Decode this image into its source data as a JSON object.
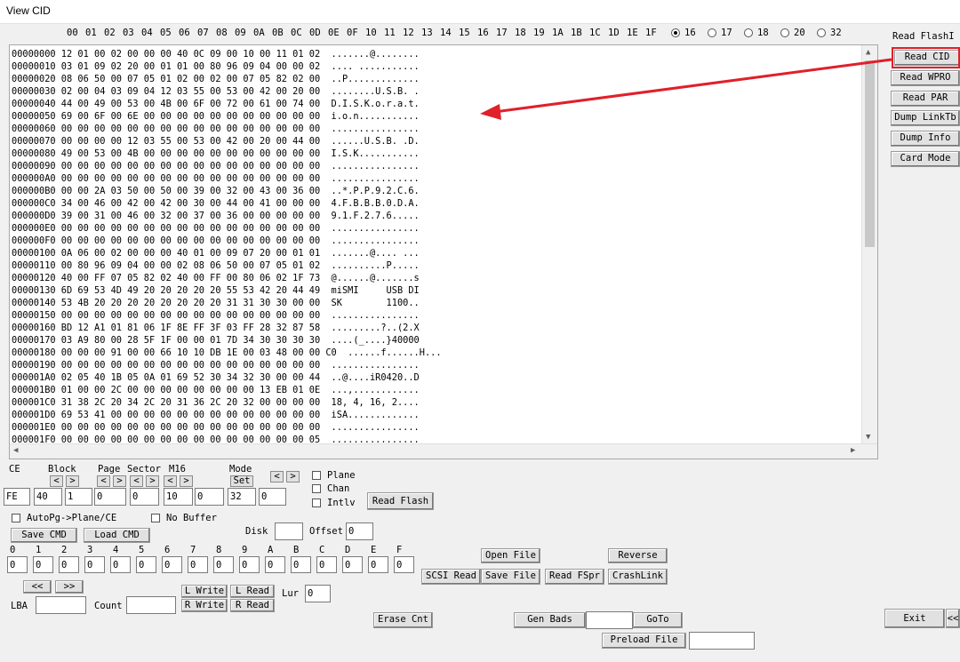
{
  "window": {
    "title": "View CID"
  },
  "header": {
    "columns": [
      "00",
      "01",
      "02",
      "03",
      "04",
      "05",
      "06",
      "07",
      "08",
      "09",
      "0A",
      "0B",
      "0C",
      "0D",
      "0E",
      "0F",
      "10",
      "11",
      "12",
      "13",
      "14",
      "15",
      "16",
      "17",
      "18",
      "19",
      "1A",
      "1B",
      "1C",
      "1D",
      "1E",
      "1F"
    ],
    "width_options": [
      {
        "label": "16",
        "selected": true
      },
      {
        "label": "17",
        "selected": false
      },
      {
        "label": "18",
        "selected": false
      },
      {
        "label": "20",
        "selected": false
      },
      {
        "label": "32",
        "selected": false
      }
    ]
  },
  "dump": {
    "lines": [
      "00000000 12 01 00 02 00 00 00 40 0C 09 00 10 00 11 01 02  .......@........",
      "00000010 03 01 09 02 20 00 01 01 00 80 96 09 04 00 00 02  .... ...........",
      "00000020 08 06 50 00 07 05 01 02 00 02 00 07 05 82 02 00  ..P.............",
      "00000030 02 00 04 03 09 04 12 03 55 00 53 00 42 00 20 00  ........U.S.B. .",
      "00000040 44 00 49 00 53 00 4B 00 6F 00 72 00 61 00 74 00  D.I.S.K.o.r.a.t.",
      "00000050 69 00 6F 00 6E 00 00 00 00 00 00 00 00 00 00 00  i.o.n...........",
      "00000060 00 00 00 00 00 00 00 00 00 00 00 00 00 00 00 00  ................",
      "00000070 00 00 00 00 12 03 55 00 53 00 42 00 20 00 44 00  ......U.S.B. .D.",
      "00000080 49 00 53 00 4B 00 00 00 00 00 00 00 00 00 00 00  I.S.K...........",
      "00000090 00 00 00 00 00 00 00 00 00 00 00 00 00 00 00 00  ................",
      "000000A0 00 00 00 00 00 00 00 00 00 00 00 00 00 00 00 00  ................",
      "000000B0 00 00 2A 03 50 00 50 00 39 00 32 00 43 00 36 00  ..*.P.P.9.2.C.6.",
      "000000C0 34 00 46 00 42 00 42 00 30 00 44 00 41 00 00 00  4.F.B.B.B.0.D.A.",
      "000000D0 39 00 31 00 46 00 32 00 37 00 36 00 00 00 00 00  9.1.F.2.7.6.....",
      "000000E0 00 00 00 00 00 00 00 00 00 00 00 00 00 00 00 00  ................",
      "000000F0 00 00 00 00 00 00 00 00 00 00 00 00 00 00 00 00  ................",
      "00000100 0A 06 00 02 00 00 00 40 01 00 09 07 20 00 01 01  .......@.... ...",
      "00000110 00 80 96 09 04 00 00 02 08 06 50 00 07 05 01 02  ..........P.....",
      "00000120 40 00 FF 07 05 82 02 40 00 FF 00 80 06 02 1F 73  @......@.......s",
      "00000130 6D 69 53 4D 49 20 20 20 20 20 55 53 42 20 44 49  miSMI     USB DI",
      "00000140 53 4B 20 20 20 20 20 20 20 20 31 31 30 30 00 00  SK        1100..",
      "00000150 00 00 00 00 00 00 00 00 00 00 00 00 00 00 00 00  ................",
      "00000160 BD 12 A1 01 81 06 1F 8E FF 3F 03 FF 28 32 87 58  .........?..(2.X",
      "00000170 03 A9 80 00 28 5F 1F 00 00 01 7D 34 30 30 30 30  ....(_....}40000",
      "00000180 00 00 00 91 00 00 66 10 10 DB 1E 00 03 48 00 00 C0  ......f......H...",
      "00000190 00 00 00 00 00 00 00 00 00 00 00 00 00 00 00 00  ................",
      "000001A0 02 05 40 1B 05 0A 01 69 52 30 34 32 30 00 00 44  ..@....iR0420..D",
      "000001B0 01 00 00 2C 00 00 00 00 00 00 00 00 13 EB 01 0E  ...,............",
      "000001C0 31 38 2C 20 34 2C 20 31 36 2C 20 32 00 00 00 00  18, 4, 16, 2....",
      "000001D0 69 53 41 00 00 00 00 00 00 00 00 00 00 00 00 00  iSA.............",
      "000001E0 00 00 00 00 00 00 00 00 00 00 00 00 00 00 00 00  ................",
      "000001F0 00 00 00 00 00 00 00 00 00 00 00 00 00 00 00 05  ................"
    ]
  },
  "right_panel": {
    "read_flash_id": "Read FlashI",
    "read_cid": "Read CID",
    "read_wpro": "Read WPRO",
    "read_par": "Read PAR",
    "dump_linktb": "Dump LinkTb",
    "dump_info": "Dump Info",
    "card_mode": "Card Mode"
  },
  "params": {
    "ce_label": "CE",
    "block_label": "Block",
    "page_label": "Page",
    "sector_label": "Sector",
    "m16_label": "M16",
    "mode_label": "Mode",
    "mode_set": "Set",
    "values": {
      "ce": "FE",
      "block_a": "40",
      "block_b": "1",
      "page_a": "0",
      "page_b": "0",
      "sector_a": "10",
      "sector_b": "0",
      "mode_a": "32",
      "mode_b": "0"
    },
    "plane": "Plane",
    "chan": "Chan",
    "intlv": "Intlv",
    "read_flash": "Read Flash",
    "autopg": "AutoPg->Plane/CE",
    "no_buffer": "No Buffer",
    "save_cmd": "Save CMD",
    "load_cmd": "Load CMD",
    "disk_label": "Disk",
    "disk_value": "",
    "offset_label": "Offset",
    "offset_value": "0",
    "prev": "<",
    "next": ">"
  },
  "regs": {
    "labels": [
      "0",
      "1",
      "2",
      "3",
      "4",
      "5",
      "6",
      "7",
      "8",
      "9",
      "A",
      "B",
      "C",
      "D",
      "E",
      "F"
    ],
    "values": [
      "0",
      "0",
      "0",
      "0",
      "0",
      "0",
      "0",
      "0",
      "0",
      "0",
      "0",
      "0",
      "0",
      "0",
      "0",
      "0"
    ]
  },
  "actions": {
    "open_file": "Open File",
    "reverse": "Reverse",
    "scsi_read": "SCSI Read",
    "save_file": "Save File",
    "read_fspr": "Read FSpr",
    "crashlink": "CrashLink",
    "lba_prev": "<<",
    "lba_next": ">>",
    "lba_label": "LBA",
    "lba_value": "",
    "count_label": "Count",
    "count_value": "",
    "l_write": "L Write",
    "l_read": "L Read",
    "r_write": "R Write",
    "r_read": "R Read",
    "lur_label": "Lur",
    "lur_value": "0",
    "erase_cnt": "Erase Cnt",
    "gen_bads": "Gen Bads",
    "gen_bads_value": "",
    "goto": "GoTo",
    "preload_file": "Preload File",
    "preload_value": "",
    "exit": "Exit",
    "more": "<<"
  }
}
